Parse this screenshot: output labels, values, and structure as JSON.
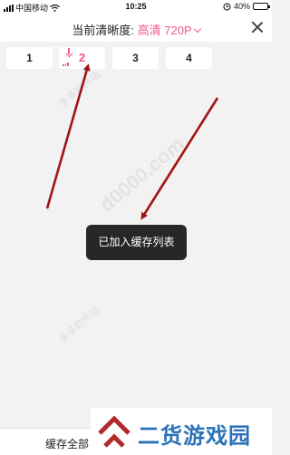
{
  "status_bar": {
    "carrier": "中国移动",
    "time": "10:25",
    "battery": "40%",
    "battery_level": 0.4
  },
  "header": {
    "label": "当前清晰度:",
    "quality": "高清 720P"
  },
  "episodes": [
    {
      "label": "1",
      "active": false
    },
    {
      "label": "2",
      "active": true
    },
    {
      "label": "3",
      "active": false
    },
    {
      "label": "4",
      "active": false
    }
  ],
  "toast": "已加入缓存列表",
  "bottom": {
    "save_all": "缓存全部"
  },
  "brand": {
    "name": "二货游戏园"
  },
  "watermark": {
    "text": "d0000.com",
    "small": "多多软件站"
  },
  "colors": {
    "accent": "#ef5b8f",
    "arrow": "#a01414",
    "brand": "#2d72b8",
    "brand_logo": "#b22a2a"
  }
}
